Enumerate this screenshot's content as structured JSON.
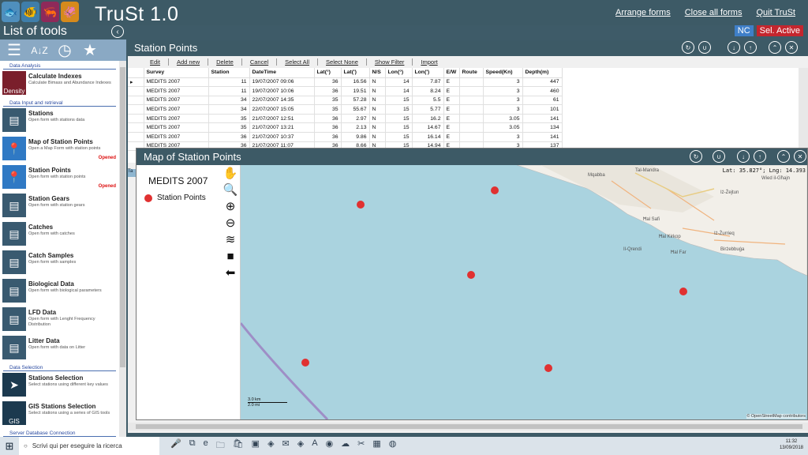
{
  "app": {
    "title": "TruSt 1.0"
  },
  "top_links": [
    "Arrange forms",
    "Close all forms",
    "Quit TruSt"
  ],
  "left_panel": {
    "title": "List of tools",
    "sections": [
      {
        "label": "Data Analysis",
        "items": [
          {
            "name": "Calculate Indexes",
            "desc": "Calculate Bimass and Abundance Indexes",
            "icon_label": "Density",
            "opened": ""
          }
        ]
      },
      {
        "label": "Data Input and retrieval",
        "items": [
          {
            "name": "Stations",
            "desc": "Open form with stations data",
            "opened": ""
          },
          {
            "name": "Map of Station Points",
            "desc": "Open a Map Form with station points",
            "opened": "Opened"
          },
          {
            "name": "Station Points",
            "desc": "Open form with station points",
            "opened": "Opened"
          },
          {
            "name": "Station Gears",
            "desc": "Open form with station gears",
            "opened": ""
          },
          {
            "name": "Catches",
            "desc": "Open form with catches",
            "opened": ""
          },
          {
            "name": "Catch Samples",
            "desc": "Open form with samples",
            "opened": ""
          },
          {
            "name": "Biological Data",
            "desc": "Open form with biological parameters",
            "opened": ""
          },
          {
            "name": "LFD Data",
            "desc": "Open form with Lenght Frequency Distribution",
            "opened": ""
          },
          {
            "name": "Litter Data",
            "desc": "Open form with data on Litter",
            "opened": ""
          }
        ]
      },
      {
        "label": "Data Selection",
        "items": [
          {
            "name": "Stations Selection",
            "desc": "Select stations using different key values",
            "opened": ""
          },
          {
            "name": "GIS Stations Selection",
            "desc": "Select stations using a series of GIS tools",
            "icon_label": "GIS",
            "opened": ""
          }
        ]
      },
      {
        "label": "Server Database Connection",
        "items": []
      }
    ]
  },
  "badges": {
    "nc": "NC",
    "sel_active": "Sel. Active"
  },
  "station_points": {
    "title": "Station Points",
    "toolbar": [
      "Edit",
      "Add new",
      "Delete",
      "Cancel",
      "Select All",
      "Select None",
      "Show Filter",
      "Import"
    ],
    "columns": [
      "Survey",
      "Station",
      "DateTime",
      "Lat(°)",
      "Lat(')",
      "N/S",
      "Lon(°)",
      "Lon(')",
      "E/W",
      "Route",
      "Speed(Kn)",
      "Depth(m)"
    ],
    "rows": [
      [
        "MEDITS 2007",
        "11",
        "19/07/2007 09:06",
        "36",
        "16.56",
        "N",
        "14",
        "7.87",
        "E",
        "",
        "3",
        "447"
      ],
      [
        "MEDITS 2007",
        "11",
        "19/07/2007 10:06",
        "36",
        "19.51",
        "N",
        "14",
        "8.24",
        "E",
        "",
        "3",
        "460"
      ],
      [
        "MEDITS 2007",
        "34",
        "22/07/2007 14:35",
        "35",
        "57.28",
        "N",
        "15",
        "5.5",
        "E",
        "",
        "3",
        "61"
      ],
      [
        "MEDITS 2007",
        "34",
        "22/07/2007 15:05",
        "35",
        "55.67",
        "N",
        "15",
        "5.77",
        "E",
        "",
        "3",
        "101"
      ],
      [
        "MEDITS 2007",
        "35",
        "21/07/2007 12:51",
        "36",
        "2.97",
        "N",
        "15",
        "16.2",
        "E",
        "",
        "3.05",
        "141"
      ],
      [
        "MEDITS 2007",
        "35",
        "21/07/2007 13:21",
        "36",
        "2.13",
        "N",
        "15",
        "14.67",
        "E",
        "",
        "3.05",
        "134"
      ],
      [
        "MEDITS 2007",
        "36",
        "21/07/2007 10:37",
        "36",
        "9.86",
        "N",
        "15",
        "16.14",
        "E",
        "",
        "3",
        "141"
      ],
      [
        "MEDITS 2007",
        "36",
        "21/07/2007 11:07",
        "36",
        "8.66",
        "N",
        "15",
        "14.94",
        "E",
        "",
        "3",
        "137"
      ]
    ]
  },
  "map": {
    "title": "Map of Station Points",
    "legend_name": "MEDITS 2007",
    "legend_item": "Station Points",
    "coords": "Lat: 35.827°; Lng: 14.393",
    "scale_km": "3.0 km",
    "scale_mi": "2.0 mi",
    "attribution": "© OpenStreetMap contributors",
    "places": [
      "Mqabba",
      "Tal-Mandra",
      "Il-Qrendi",
      "Iż-Żurrieq",
      "Birżebbuġa",
      "Iż-Żejtun",
      "Wied il-Għajn",
      "Ħal Kirkop",
      "Ħal Safi",
      "Ħal Far"
    ],
    "point_color": "#e03131",
    "points_label": "Station Points"
  },
  "taskbar": {
    "search_placeholder": "Scrivi qui per eseguire la ricerca",
    "time": "11:32",
    "date": "13/09/2018"
  },
  "tab_stub": "Ta"
}
